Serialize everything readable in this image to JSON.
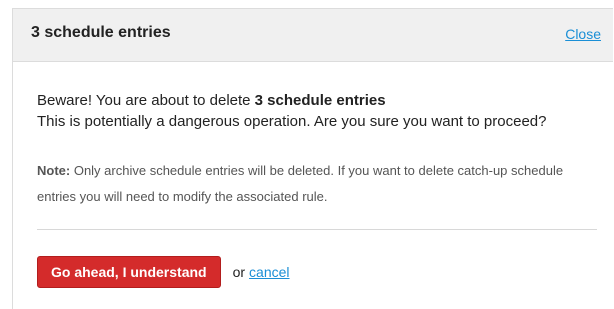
{
  "dialog": {
    "title": "3 schedule entries",
    "close_label": "Close"
  },
  "body": {
    "line1_prefix": "Beware! You are about to delete ",
    "line1_bold": "3 schedule entries",
    "line2": "This is potentially a dangerous operation. Are you sure you want to proceed?",
    "note_label": "Note:",
    "note_text": " Only archive schedule entries will be deleted. If you want to delete catch-up schedule entries you will need to modify the associated rule."
  },
  "actions": {
    "confirm_label": "Go ahead, I understand",
    "or_text": "or",
    "cancel_label": "cancel"
  },
  "colors": {
    "confirm_button": "#d42b2b",
    "link": "#1a8fd6",
    "header_bg": "#f0f0f0"
  }
}
